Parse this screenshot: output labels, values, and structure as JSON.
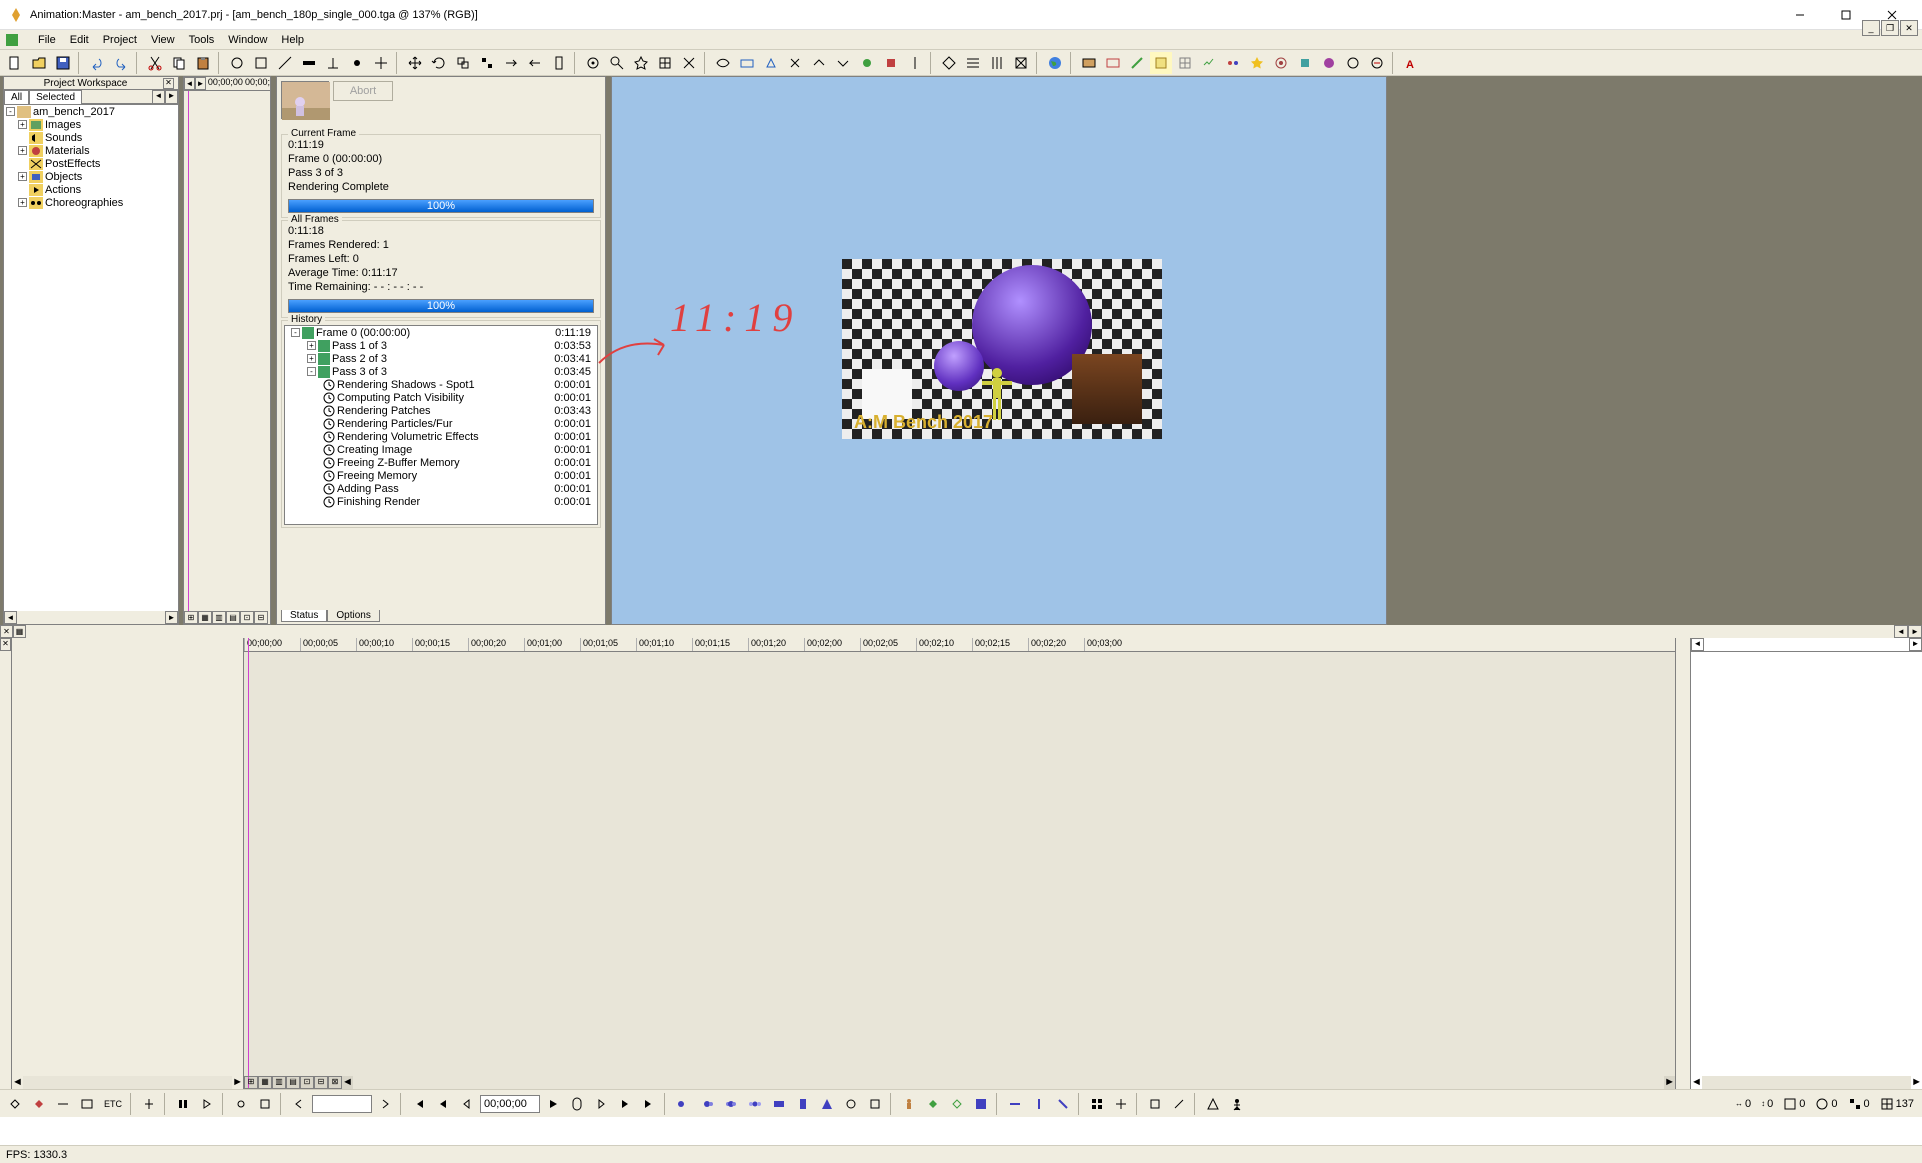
{
  "title": "Animation:Master - am_bench_2017.prj - [am_bench_180p_single_000.tga @ 137% (RGB)]",
  "menubar": [
    "File",
    "Edit",
    "Project",
    "View",
    "Tools",
    "Window",
    "Help"
  ],
  "workspace": {
    "title": "Project Workspace",
    "tabs": [
      "All",
      "Selected"
    ],
    "tree": {
      "root": "am_bench_2017",
      "items": [
        "Images",
        "Sounds",
        "Materials",
        "PostEffects",
        "Objects",
        "Actions",
        "Choreographies"
      ]
    }
  },
  "timeline_top": {
    "tc1": "00;00;00",
    "tc2": "00;00;"
  },
  "render": {
    "abort": "Abort",
    "current_frame": {
      "title": "Current Frame",
      "elapsed": "0:11:19",
      "frame": "Frame 0 (00:00:00)",
      "pass": "Pass 3 of 3",
      "status": "Rendering Complete",
      "pct": "100%"
    },
    "all_frames": {
      "title": "All Frames",
      "elapsed": "0:11:18",
      "rendered": "Frames Rendered: 1",
      "left": "Frames Left: 0",
      "avg": "Average Time:   0:11:17",
      "remaining": "Time Remaining: - - : - - : - -",
      "pct": "100%"
    },
    "history": {
      "title": "History",
      "items": [
        {
          "i": 1,
          "sq": "-",
          "ic": "frame",
          "t": "Frame 0 (00:00:00)",
          "tm": "0:11:19"
        },
        {
          "i": 2,
          "sq": "+",
          "ic": "pass",
          "t": "Pass 1 of 3",
          "tm": "0:03:53"
        },
        {
          "i": 2,
          "sq": "+",
          "ic": "pass",
          "t": "Pass 2 of 3",
          "tm": "0:03:41"
        },
        {
          "i": 2,
          "sq": "-",
          "ic": "pass",
          "t": "Pass 3 of 3",
          "tm": "0:03:45"
        },
        {
          "i": 3,
          "sq": "",
          "ic": "clock",
          "t": "Rendering Shadows - Spot1",
          "tm": "0:00:01"
        },
        {
          "i": 3,
          "sq": "",
          "ic": "clock",
          "t": "Computing Patch Visibility",
          "tm": "0:00:01"
        },
        {
          "i": 3,
          "sq": "",
          "ic": "clock",
          "t": "Rendering Patches",
          "tm": "0:03:43"
        },
        {
          "i": 3,
          "sq": "",
          "ic": "clock",
          "t": "Rendering Particles/Fur",
          "tm": "0:00:01"
        },
        {
          "i": 3,
          "sq": "",
          "ic": "clock",
          "t": "Rendering Volumetric Effects",
          "tm": "0:00:01"
        },
        {
          "i": 3,
          "sq": "",
          "ic": "clock",
          "t": "Creating Image",
          "tm": "0:00:01"
        },
        {
          "i": 3,
          "sq": "",
          "ic": "clock",
          "t": "Freeing Z-Buffer Memory",
          "tm": "0:00:01"
        },
        {
          "i": 3,
          "sq": "",
          "ic": "clock",
          "t": "Freeing Memory",
          "tm": "0:00:01"
        },
        {
          "i": 3,
          "sq": "",
          "ic": "clock",
          "t": "Adding Pass",
          "tm": "0:00:01"
        },
        {
          "i": 3,
          "sq": "",
          "ic": "clock",
          "t": "Finishing Render",
          "tm": "0:00:01"
        }
      ]
    },
    "tabs": [
      "Status",
      "Options"
    ]
  },
  "viewport": {
    "caption": "A:M Bench 2017"
  },
  "annotation": {
    "text": "11:19"
  },
  "timeline_bottom": {
    "ticks": [
      "00;00;00",
      "00;00;05",
      "00;00;10",
      "00;00;15",
      "00;00;20",
      "00;01;00",
      "00;01;05",
      "00;01;10",
      "00;01;15",
      "00;01;20",
      "00;02;00",
      "00;02;05",
      "00;02;10",
      "00;02;15",
      "00;02;20",
      "00;03;00"
    ]
  },
  "playbar": {
    "time": "00;00;00"
  },
  "statusbar": {
    "fps": "FPS: 1330.3"
  },
  "coords": {
    "a": "0",
    "b": "0",
    "c": "0",
    "d": "0",
    "e": "0",
    "f": "137"
  }
}
